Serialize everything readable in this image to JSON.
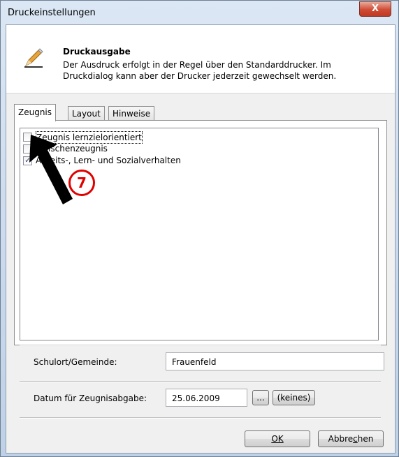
{
  "window": {
    "title": "Druckeinstellungen",
    "close_label": "X"
  },
  "header": {
    "icon": "pencil-icon",
    "title": "Druckausgabe",
    "line1": "Der Ausdruck erfolgt in der Regel über den Standarddrucker. Im",
    "line2": "Druckdialog kann aber der Drucker jederzeit gewechselt werden."
  },
  "tabs": [
    {
      "label": "Zeugnis",
      "active": true
    },
    {
      "label": "Layout",
      "active": false
    },
    {
      "label": "Hinweise",
      "active": false
    }
  ],
  "options": [
    {
      "label": "Zeugnis lernzielorientiert",
      "checked": false,
      "focused": true
    },
    {
      "label": "Zwischenzeugnis",
      "checked": false
    },
    {
      "label": "Arbeits-, Lern- und Sozialverhalten",
      "checked": true
    }
  ],
  "form": {
    "schulort_label": "Schulort/Gemeinde:",
    "schulort_value": "Frauenfeld",
    "datum_label": "Datum für Zeugnisabgabe:",
    "datum_value": "25.06.2009",
    "browse_label": "...",
    "keines_label": "(keines)"
  },
  "buttons": {
    "ok_label": "OK",
    "cancel_pre": "Abbre",
    "cancel_mnemonic": "c",
    "cancel_post": "hen"
  },
  "annotation": {
    "number": "7",
    "color": "#e00000"
  },
  "colors": {
    "accent": "#cf4b33",
    "window_frame": "#c9d9ec",
    "dialog_bg": "#f0f0f0"
  }
}
